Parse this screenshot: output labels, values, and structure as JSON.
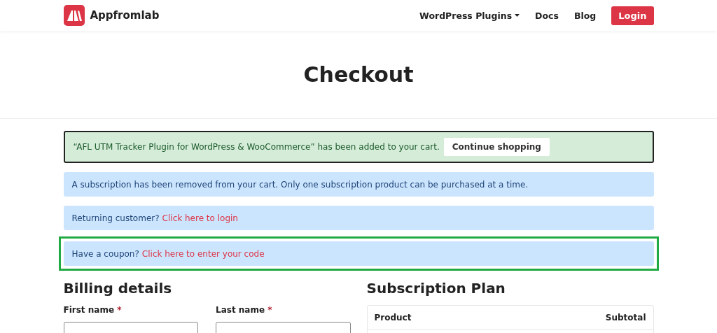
{
  "header": {
    "brand": "Appfromlab",
    "nav": [
      {
        "label": "WordPress Plugins",
        "dropdown": true
      },
      {
        "label": "Docs",
        "dropdown": false
      },
      {
        "label": "Blog",
        "dropdown": false
      }
    ],
    "login": "Login"
  },
  "page_title": "Checkout",
  "notices": [
    {
      "kind": "success",
      "text": "“AFL UTM Tracker Plugin for WordPress & WooCommerce” has been added to your cart.",
      "button": "Continue shopping",
      "highlighted": false
    },
    {
      "kind": "info",
      "text": "A subscription has been removed from your cart. Only one subscription product can be purchased at a time.",
      "highlighted": false
    },
    {
      "kind": "info",
      "text": "Returning customer?",
      "link": "Click here to login",
      "highlighted": false
    },
    {
      "kind": "info",
      "text": "Have a coupon?",
      "link": "Click here to enter your code",
      "highlighted": true
    }
  ],
  "billing": {
    "title": "Billing details",
    "fields": [
      {
        "label": "First name",
        "required_mark": "*"
      },
      {
        "label": "Last name",
        "required_mark": "*"
      }
    ]
  },
  "plan": {
    "title": "Subscription Plan",
    "columns": [
      "Product",
      "Subtotal"
    ]
  }
}
